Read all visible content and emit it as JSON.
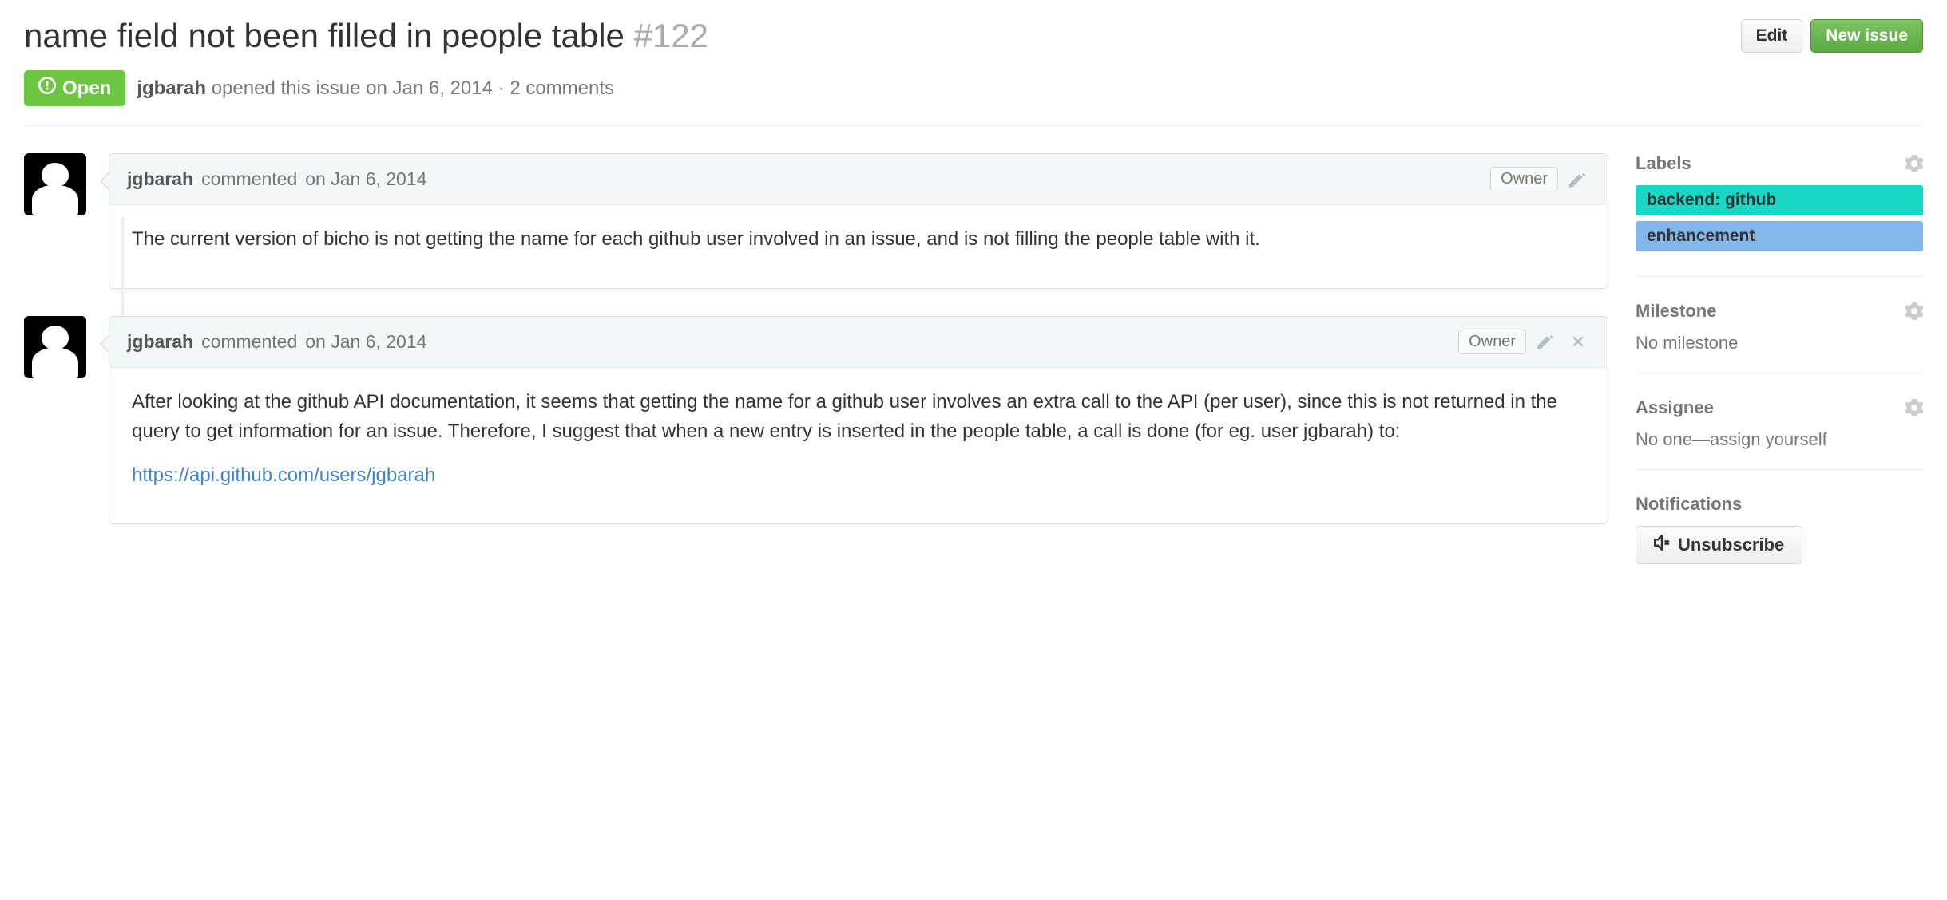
{
  "header": {
    "title": "name field not been filled in people table",
    "issue_number": "#122",
    "edit_label": "Edit",
    "new_issue_label": "New issue"
  },
  "meta": {
    "state": "Open",
    "author": "jgbarah",
    "opened_text": "opened this issue",
    "date_text": "on Jan 6, 2014",
    "comments_text": "2 comments"
  },
  "comments": [
    {
      "author": "jgbarah",
      "action": "commented",
      "date": "on Jan 6, 2014",
      "role": "Owner",
      "can_delete": false,
      "body_text": "The current version of bicho is not getting the name for each github user involved in an issue, and is not filling the people table with it."
    },
    {
      "author": "jgbarah",
      "action": "commented",
      "date": "on Jan 6, 2014",
      "role": "Owner",
      "can_delete": true,
      "body_text": "After looking at the github API documentation, it seems that getting the name for a github user involves an extra call to the API (per user), since this is not returned in the query to get information for an issue. Therefore, I suggest that when a new entry is inserted in the people table, a call is done (for eg. user jgbarah) to:",
      "link_text": "https://api.github.com/users/jgbarah"
    }
  ],
  "sidebar": {
    "labels_title": "Labels",
    "labels": [
      {
        "text": "backend: github",
        "color": "#1ad6c4"
      },
      {
        "text": "enhancement",
        "color": "#84b6eb"
      }
    ],
    "milestone_title": "Milestone",
    "milestone_text": "No milestone",
    "assignee_title": "Assignee",
    "assignee_prefix": "No one—",
    "assignee_link": "assign yourself",
    "notifications_title": "Notifications",
    "unsubscribe_label": "Unsubscribe"
  }
}
